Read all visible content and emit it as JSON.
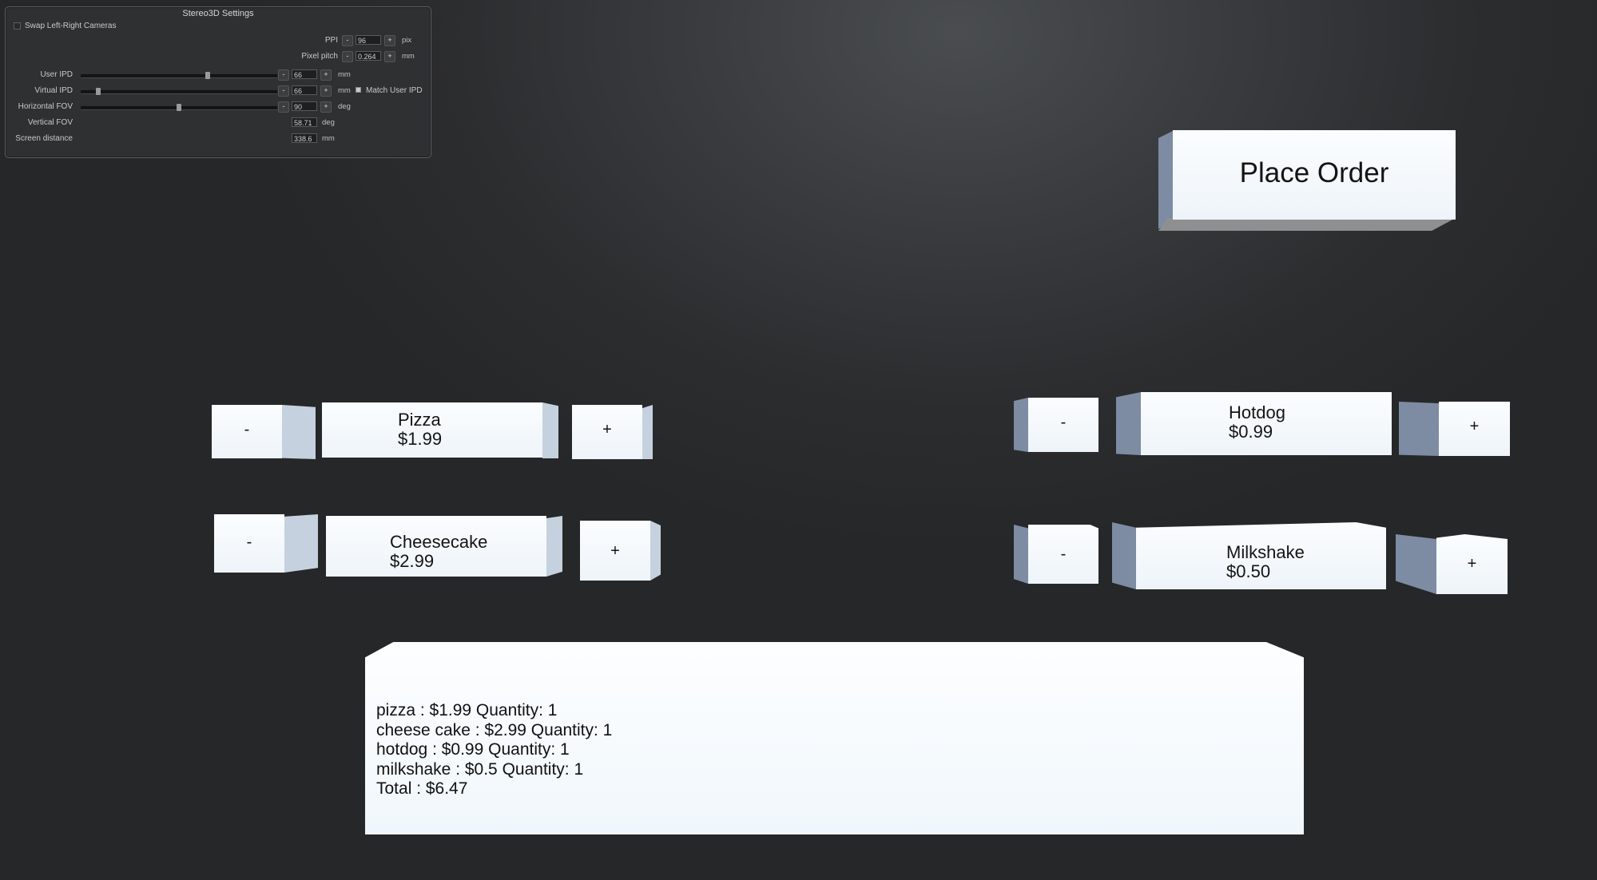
{
  "settings_panel": {
    "title": "Stereo3D Settings",
    "swap_cameras_label": "Swap Left-Right Cameras",
    "ppi": {
      "label": "PPI",
      "value": "96",
      "unit": "pix"
    },
    "pixel_pitch": {
      "label": "Pixel pitch",
      "value": "0.264",
      "unit": "mm"
    },
    "user_ipd": {
      "label": "User IPD",
      "value": "66",
      "unit": "mm",
      "slider_level": 0.65
    },
    "virtual_ipd": {
      "label": "Virtual IPD",
      "value": "66",
      "unit": "mm",
      "slider_level": 0.08,
      "match_label": "Match User IPD"
    },
    "horizontal_fov": {
      "label": "Horizontal FOV",
      "value": "90",
      "unit": "deg",
      "slider_level": 0.5
    },
    "vertical_fov": {
      "label": "Vertical FOV",
      "value": "58.71",
      "unit": "deg"
    },
    "screen_distance": {
      "label": "Screen distance",
      "value": "338.6",
      "unit": "mm"
    },
    "minus": "-",
    "plus": "+"
  },
  "place_order_label": "Place Order",
  "items": {
    "pizza": {
      "name": "Pizza",
      "price": "$1.99"
    },
    "cheesecake": {
      "name": "Cheesecake",
      "price": "$2.99"
    },
    "hotdog": {
      "name": "Hotdog",
      "price": "$0.99"
    },
    "milkshake": {
      "name": "Milkshake",
      "price": "$0.50"
    }
  },
  "buttons": {
    "minus": "-",
    "plus": "+"
  },
  "order_summary": {
    "lines": [
      "pizza : $1.99 Quantity: 1",
      "cheese cake : $2.99 Quantity: 1",
      "hotdog : $0.99 Quantity: 1",
      "milkshake : $0.5 Quantity: 1",
      "Total : $6.47"
    ]
  },
  "colors": {
    "face": "#f4f9fc",
    "side_blue": "#7d8ca3",
    "side_pale": "#c5d1df",
    "background": "#2c2d2f"
  }
}
